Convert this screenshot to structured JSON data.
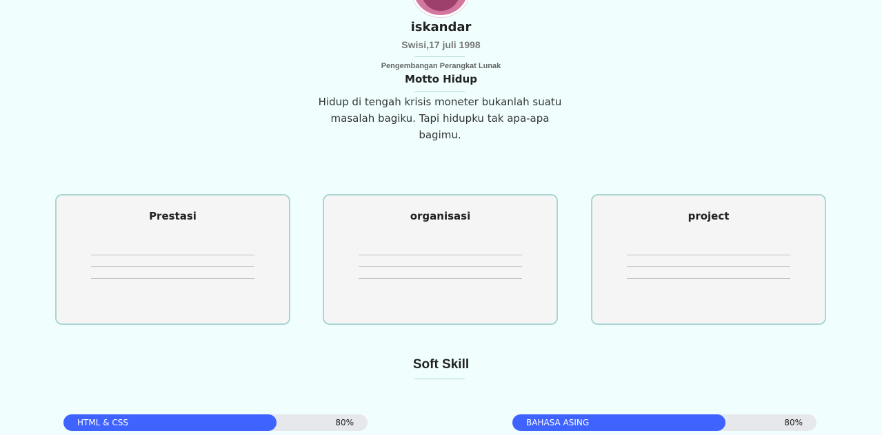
{
  "profile": {
    "name": "iskandar",
    "birth": "Swisi,17 juli 1998",
    "job": "Pengembangan Perangkat Lunak",
    "motto_title": "Motto Hidup",
    "motto": "Hidup di tengah krisis moneter bukanlah suatu masalah bagiku. Tapi hidupku tak apa-apa bagimu."
  },
  "cards": [
    {
      "title": "Prestasi"
    },
    {
      "title": "organisasi"
    },
    {
      "title": "project"
    }
  ],
  "soft_skill": {
    "title": "Soft Skill",
    "skills": [
      {
        "label": "HTML & CSS",
        "value": "80%",
        "percent": 70
      },
      {
        "label": "BAHASA ASING",
        "value": "80%",
        "percent": 70
      }
    ]
  },
  "colors": {
    "background": "#f0fffe",
    "accent": "#a9d6d1",
    "bar_fill": "#3f63ff",
    "bar_track": "#e6e8ec",
    "avatar": "#d4779f"
  }
}
